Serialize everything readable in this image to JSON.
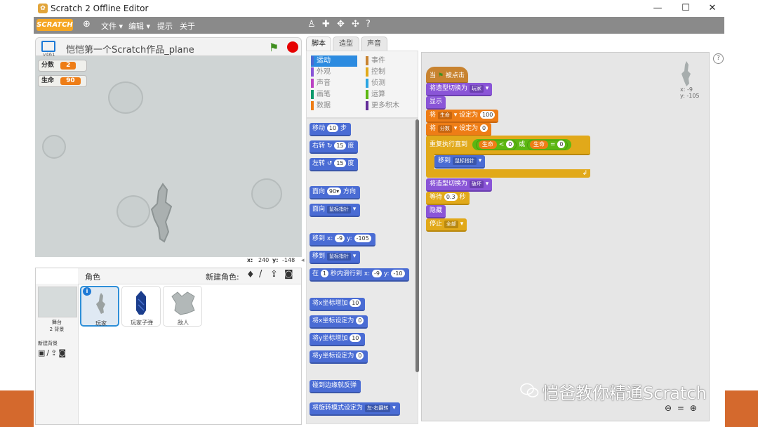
{
  "window": {
    "title": "Scratch 2 Offline Editor",
    "controls": {
      "minimize": "—",
      "maximize": "☐",
      "close": "✕"
    }
  },
  "menubar": {
    "logo": "SCRATCH",
    "items": [
      "文件 ▾",
      "编辑 ▾",
      "提示",
      "关于"
    ],
    "globe_icon": "globe-icon",
    "tools": [
      "duplicate-icon",
      "delete-icon",
      "grow-icon",
      "shrink-icon",
      "help-icon"
    ]
  },
  "stage": {
    "title": "恺恺第一个Scratch作品_plane",
    "version": "v461",
    "monitors": [
      {
        "label": "分数",
        "value": "2"
      },
      {
        "label": "生命",
        "value": "90"
      }
    ],
    "coords": {
      "x_label": "x:",
      "x": "240",
      "y_label": "y:",
      "y": "-148"
    }
  },
  "sprites": {
    "header": "角色",
    "new_sprite_label": "新建角色:",
    "stage_label": "舞台",
    "stage_backdrops": "2 背景",
    "new_backdrop_label": "新建背景",
    "list": [
      {
        "name": "玩家",
        "selected": true
      },
      {
        "name": "玩家子弹",
        "selected": false
      },
      {
        "name": "敌人",
        "selected": false
      }
    ]
  },
  "tabs": [
    "脚本",
    "造型",
    "声音"
  ],
  "categories": {
    "left": [
      {
        "label": "运动",
        "color": "#4a6cd4",
        "active": true
      },
      {
        "label": "外观",
        "color": "#8a55d7"
      },
      {
        "label": "声音",
        "color": "#bb42c3"
      },
      {
        "label": "画笔",
        "color": "#0e9a6c"
      },
      {
        "label": "数据",
        "color": "#ee7d16"
      }
    ],
    "right": [
      {
        "label": "事件",
        "color": "#c88330"
      },
      {
        "label": "控制",
        "color": "#e1a91a"
      },
      {
        "label": "侦测",
        "color": "#2ca5e2"
      },
      {
        "label": "运算",
        "color": "#5cb712"
      },
      {
        "label": "更多积木",
        "color": "#632d99"
      }
    ]
  },
  "palette": {
    "move": {
      "a": "移动",
      "n": "10",
      "b": "步"
    },
    "turn_right": {
      "a": "右转",
      "n": "15",
      "b": "度"
    },
    "turn_left": {
      "a": "左转",
      "n": "15",
      "b": "度"
    },
    "point_dir": {
      "a": "面向",
      "n": "90▾",
      "b": "方向"
    },
    "point_towards": {
      "a": "面向",
      "dd": "鼠标指针"
    },
    "goto_xy": {
      "a": "移到",
      "x_label": "x:",
      "x": "-9",
      "y_label": "y:",
      "y": "-105"
    },
    "goto": {
      "a": "移到",
      "dd": "鼠标指针"
    },
    "glide": {
      "a": "在",
      "n": "1",
      "b": "秒内滑行到",
      "x_label": "x:",
      "x": "-9",
      "y_label": "y:",
      "y": "-10"
    },
    "change_x": {
      "a": "将x坐标增加",
      "n": "10"
    },
    "set_x": {
      "a": "将x坐标设定为",
      "n": "0"
    },
    "change_y": {
      "a": "将y坐标增加",
      "n": "10"
    },
    "set_y": {
      "a": "将y坐标设定为",
      "n": "0"
    },
    "bounce": "碰到边缘就反弹",
    "rotation_style": {
      "a": "将旋转模式设定为",
      "dd": "左-右翻转"
    }
  },
  "script": {
    "hat": {
      "a": "当",
      "b": "被点击"
    },
    "costume1": {
      "a": "将造型切换为",
      "dd": "玩家"
    },
    "show": "显示",
    "set_life": {
      "a": "将",
      "dd": "生命",
      "b": "设定为",
      "v": "100"
    },
    "set_score": {
      "a": "将",
      "dd": "分数",
      "b": "设定为",
      "v": "0"
    },
    "repeat_until": {
      "a": "重复执行直到",
      "v1": "生命",
      "lt": "<",
      "n1": "0",
      "or": "或",
      "v2": "生命",
      "eq": "=",
      "n2": "0"
    },
    "goto_mouse": {
      "a": "移到",
      "dd": "鼠标指针"
    },
    "costume2": {
      "a": "将造型切换为",
      "dd": "破坏"
    },
    "wait": {
      "a": "等待",
      "n": "0.3",
      "b": "秒"
    },
    "hide": "隐藏",
    "stop": {
      "a": "停止",
      "dd": "全部"
    }
  },
  "sprite_info": {
    "x": "x: -9",
    "y": "y: -105"
  },
  "watermark": "恺爸教你精通Scratch",
  "zoom": {
    "out": "🔍-",
    "reset": "=",
    "in": "🔍+"
  }
}
